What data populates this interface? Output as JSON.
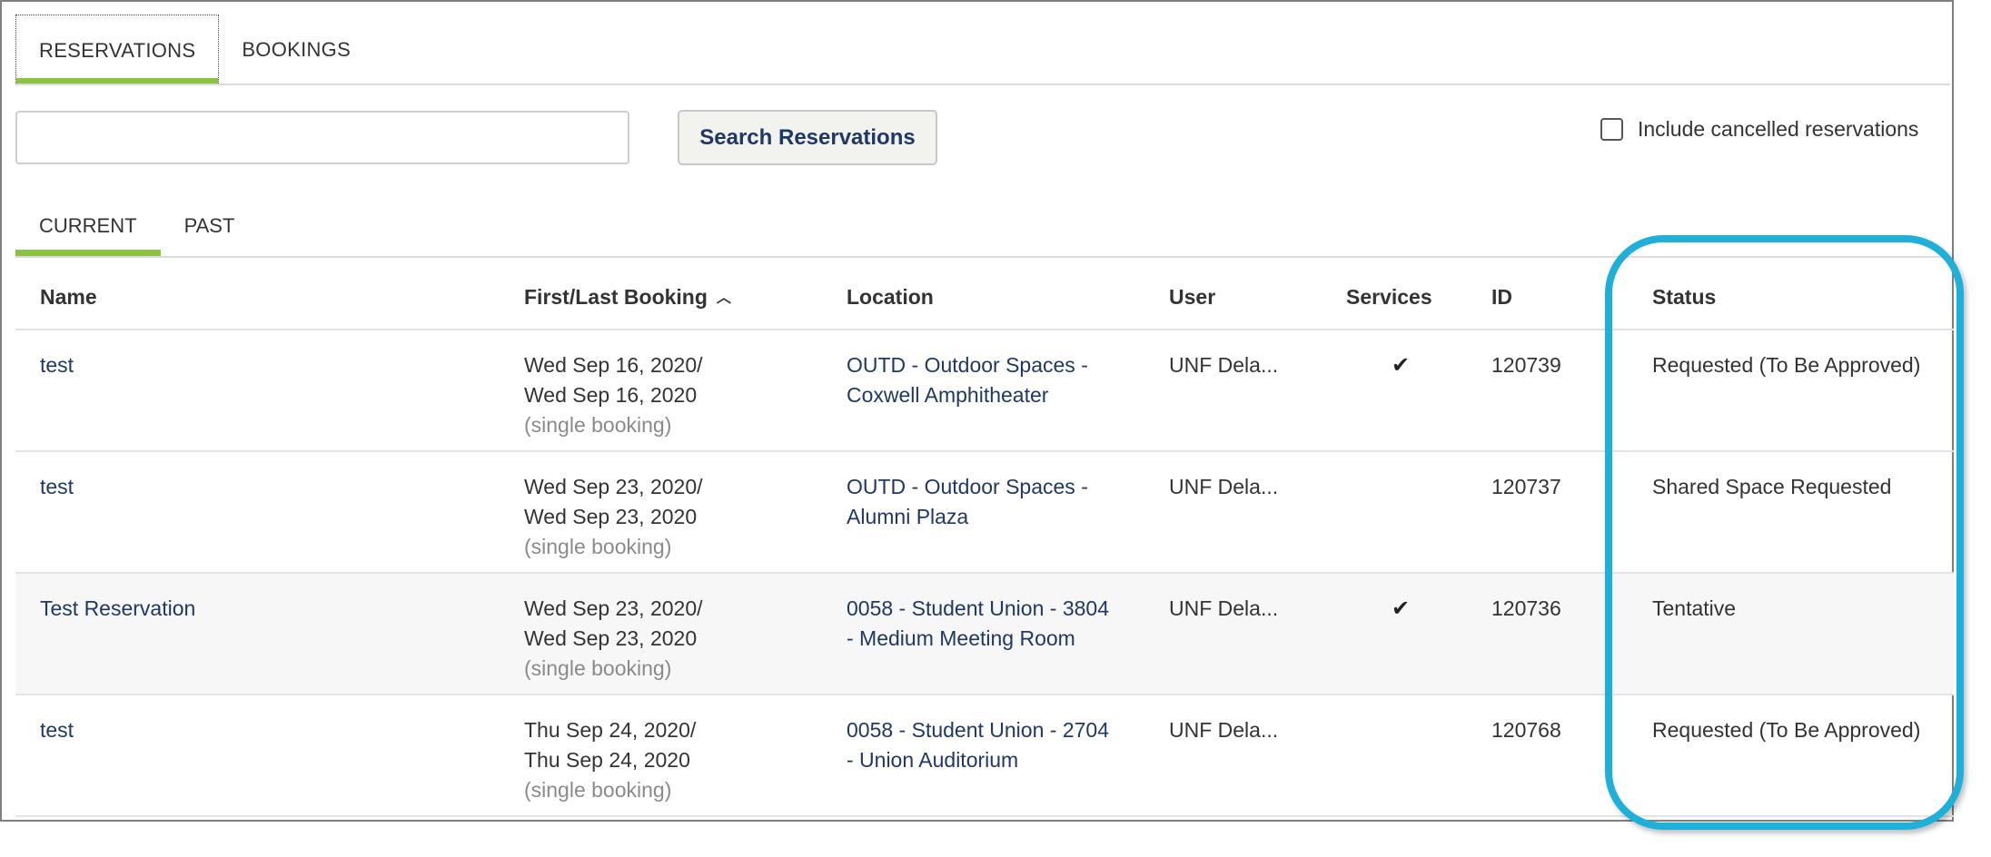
{
  "tabs": {
    "reservations": "RESERVATIONS",
    "bookings": "BOOKINGS"
  },
  "search": {
    "value": "",
    "placeholder": "",
    "button_label": "Search Reservations"
  },
  "include_cancelled": {
    "label": "Include cancelled reservations",
    "checked": false
  },
  "subtabs": {
    "current": "CURRENT",
    "past": "PAST"
  },
  "table": {
    "headers": {
      "name": "Name",
      "booking": "First/Last Booking",
      "location": "Location",
      "user": "User",
      "services": "Services",
      "id": "ID",
      "status": "Status"
    },
    "rows": [
      {
        "name": "test",
        "first": "Wed Sep 16, 2020/",
        "last": "Wed Sep 16, 2020",
        "note": "(single booking)",
        "loc1": "OUTD - Outdoor Spaces -",
        "loc2": "Coxwell Amphitheater",
        "user": "UNF Dela...",
        "services": "✔",
        "id": "120739",
        "status": "Requested (To Be Approved)"
      },
      {
        "name": "test",
        "first": "Wed Sep 23, 2020/",
        "last": "Wed Sep 23, 2020",
        "note": "(single booking)",
        "loc1": "OUTD - Outdoor Spaces -",
        "loc2": "Alumni Plaza",
        "user": "UNF Dela...",
        "services": "",
        "id": "120737",
        "status": "Shared Space Requested"
      },
      {
        "name": "Test Reservation",
        "first": "Wed Sep 23, 2020/",
        "last": "Wed Sep 23, 2020",
        "note": "(single booking)",
        "loc1": "0058 - Student Union - 3804",
        "loc2": "- Medium Meeting Room",
        "user": "UNF Dela...",
        "services": "✔",
        "id": "120736",
        "status": "Tentative"
      },
      {
        "name": "test",
        "first": "Thu Sep 24, 2020/",
        "last": "Thu Sep 24, 2020",
        "note": "(single booking)",
        "loc1": "0058 - Student Union - 2704",
        "loc2": "- Union Auditorium",
        "user": "UNF Dela...",
        "services": "",
        "id": "120768",
        "status": "Requested (To Be Approved)"
      }
    ]
  },
  "colors": {
    "accent_green": "#8ac43f",
    "link_blue": "#1f3864",
    "highlight_cyan": "#1fb0d9"
  },
  "icons": {
    "sort": "chevron-up-icon",
    "service": "checkmark-icon"
  }
}
